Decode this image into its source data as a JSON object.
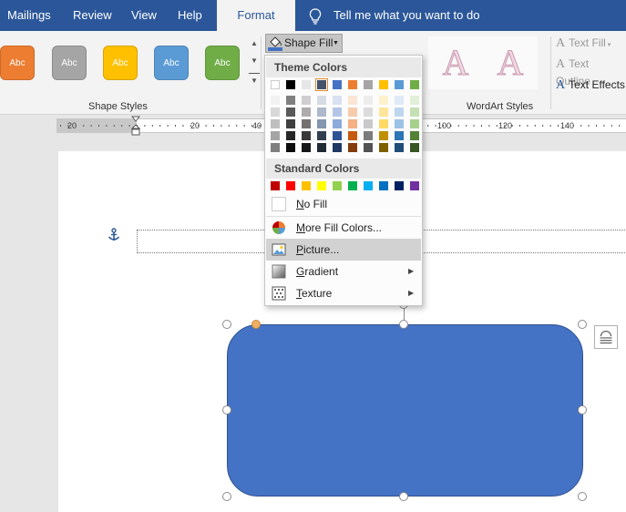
{
  "tabs": [
    "Mailings",
    "Review",
    "View",
    "Help",
    "Format"
  ],
  "active_tab": "Format",
  "tell_me": "Tell me what you want to do",
  "shape_styles": {
    "swatches": [
      {
        "label": "Abc",
        "color": "#ed7d31"
      },
      {
        "label": "Abc",
        "color": "#a5a5a5"
      },
      {
        "label": "Abc",
        "color": "#ffc000"
      },
      {
        "label": "Abc",
        "color": "#5b9bd5"
      },
      {
        "label": "Abc",
        "color": "#70ad47"
      }
    ],
    "group_label": "Shape Styles"
  },
  "shape_fill_button": "Shape Fill",
  "wordart": {
    "group_label": "WordArt Styles",
    "samples": [
      "A",
      "A"
    ],
    "text_fill": "Text Fill",
    "text_outline": "Text Outline",
    "text_effects": "Text Effects"
  },
  "ruler": {
    "numbers": [
      "20",
      "20",
      "40",
      "100",
      "120",
      "140"
    ]
  },
  "menu": {
    "theme_header": "Theme Colors",
    "standard_header": "Standard Colors",
    "theme_top_row": [
      "#ffffff",
      "#000000",
      "#e7e6e6",
      "#44546a",
      "#4472c4",
      "#ed7d31",
      "#a5a5a5",
      "#ffc000",
      "#5b9bd5",
      "#70ad47"
    ],
    "theme_tints": [
      [
        "#f2f2f2",
        "#7f7f7f",
        "#d0cece",
        "#d6dce4",
        "#d9e2f3",
        "#fbe5d5",
        "#ededed",
        "#fff2cc",
        "#deebf6",
        "#e2efd9"
      ],
      [
        "#d8d8d8",
        "#595959",
        "#aeabab",
        "#adb9ca",
        "#b4c6e7",
        "#f7cbac",
        "#dbdbdb",
        "#fee599",
        "#bdd7ee",
        "#c5e0b3"
      ],
      [
        "#bfbfbf",
        "#3f3f3f",
        "#757070",
        "#8496b0",
        "#8eaadb",
        "#f4b183",
        "#c9c9c9",
        "#ffd965",
        "#9cc3e5",
        "#a8d08d"
      ],
      [
        "#a5a5a5",
        "#262626",
        "#3a3838",
        "#323f4f",
        "#2f5496",
        "#c55a11",
        "#7b7b7b",
        "#bf9000",
        "#2e75b5",
        "#538135"
      ],
      [
        "#7f7f7f",
        "#0c0c0c",
        "#171616",
        "#222a35",
        "#1f3864",
        "#833c0b",
        "#525252",
        "#7f6000",
        "#1e4e79",
        "#375623"
      ]
    ],
    "selected_theme_color": "#44546a",
    "standard_colors": [
      "#c00000",
      "#ff0000",
      "#ffc000",
      "#ffff00",
      "#92d050",
      "#00b050",
      "#00b0f0",
      "#0070c0",
      "#002060",
      "#7030a0"
    ],
    "items": [
      {
        "key": "N",
        "rest": "o Fill",
        "icon": "no-fill-icon"
      },
      {
        "key": "M",
        "rest": "ore Fill Colors...",
        "icon": "color-wheel-icon"
      },
      {
        "key": "P",
        "rest": "icture...",
        "icon": "picture-icon"
      },
      {
        "key": "G",
        "rest": "radient",
        "icon": "gradient-icon"
      },
      {
        "key": "T",
        "rest": "exture",
        "icon": "texture-icon"
      }
    ]
  },
  "shape": {
    "fill": "#4472c4"
  }
}
